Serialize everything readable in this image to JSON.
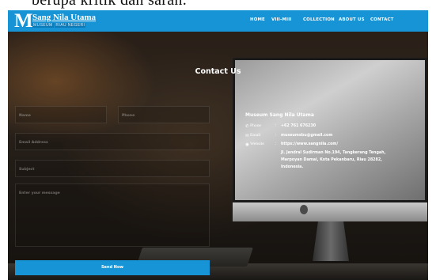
{
  "document_line": "berupa kritik dan saran.",
  "header": {
    "logo_letter": "M",
    "logo_name": "Sang Nila Utama",
    "logo_tagline_left": "MUSEUM",
    "logo_tagline_right": "RIAU NEGERI",
    "nav": [
      "HOME",
      "VIII-MIII",
      "COLLECTION",
      "ABOUT US",
      "CONTACT"
    ]
  },
  "contact": {
    "title": "Contact Us",
    "form": {
      "name_placeholder": "Name",
      "phone_placeholder": "Phone",
      "email_placeholder": "Email Address",
      "subject_placeholder": "Subject",
      "message_placeholder": "Enter your message",
      "submit_label": "Send Now"
    },
    "info": {
      "title": "Museum Sang Nila Utama",
      "phone_label": "Phone",
      "phone": "+62 761 676230",
      "email_label": "Email",
      "email": "museumsbu@gmail.com",
      "website_label": "Website",
      "website": "https://www.sangnila.com/",
      "address_lines": [
        "Jl. Jendral Sudirman No.194, Tangkerang Tengah,",
        "Marpoyan Damai, Kota Pekanbaru, Riau 28282,",
        "Indonesia."
      ]
    }
  },
  "colors": {
    "accent": "#1694d6",
    "nav_bg": "#1694d6",
    "button": "#1694d6"
  },
  "icons": [
    "phone-icon",
    "envelope-icon",
    "globe-icon"
  ]
}
